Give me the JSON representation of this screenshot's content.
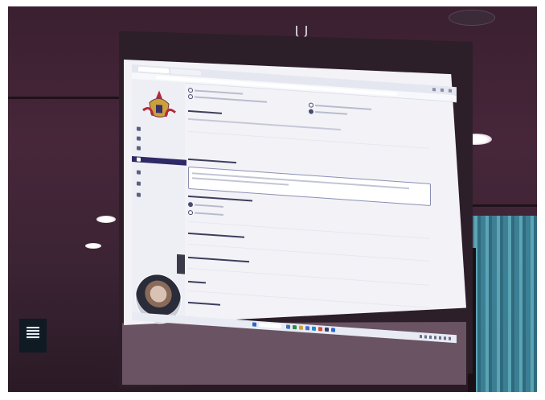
{
  "scene": {
    "description_colors": {
      "wall": "#47263a",
      "screen": "#f3f2f7",
      "sidebar_active": "#2e2a66",
      "curtain": "#4fa0b4"
    }
  },
  "projected_app": {
    "sidebar_icons": [
      "crest-logo",
      "home-icon",
      "form-icon",
      "list-icon",
      "edit-icon",
      "group-icon",
      "chart-icon",
      "settings-icon"
    ],
    "active_menu_index": 3
  }
}
